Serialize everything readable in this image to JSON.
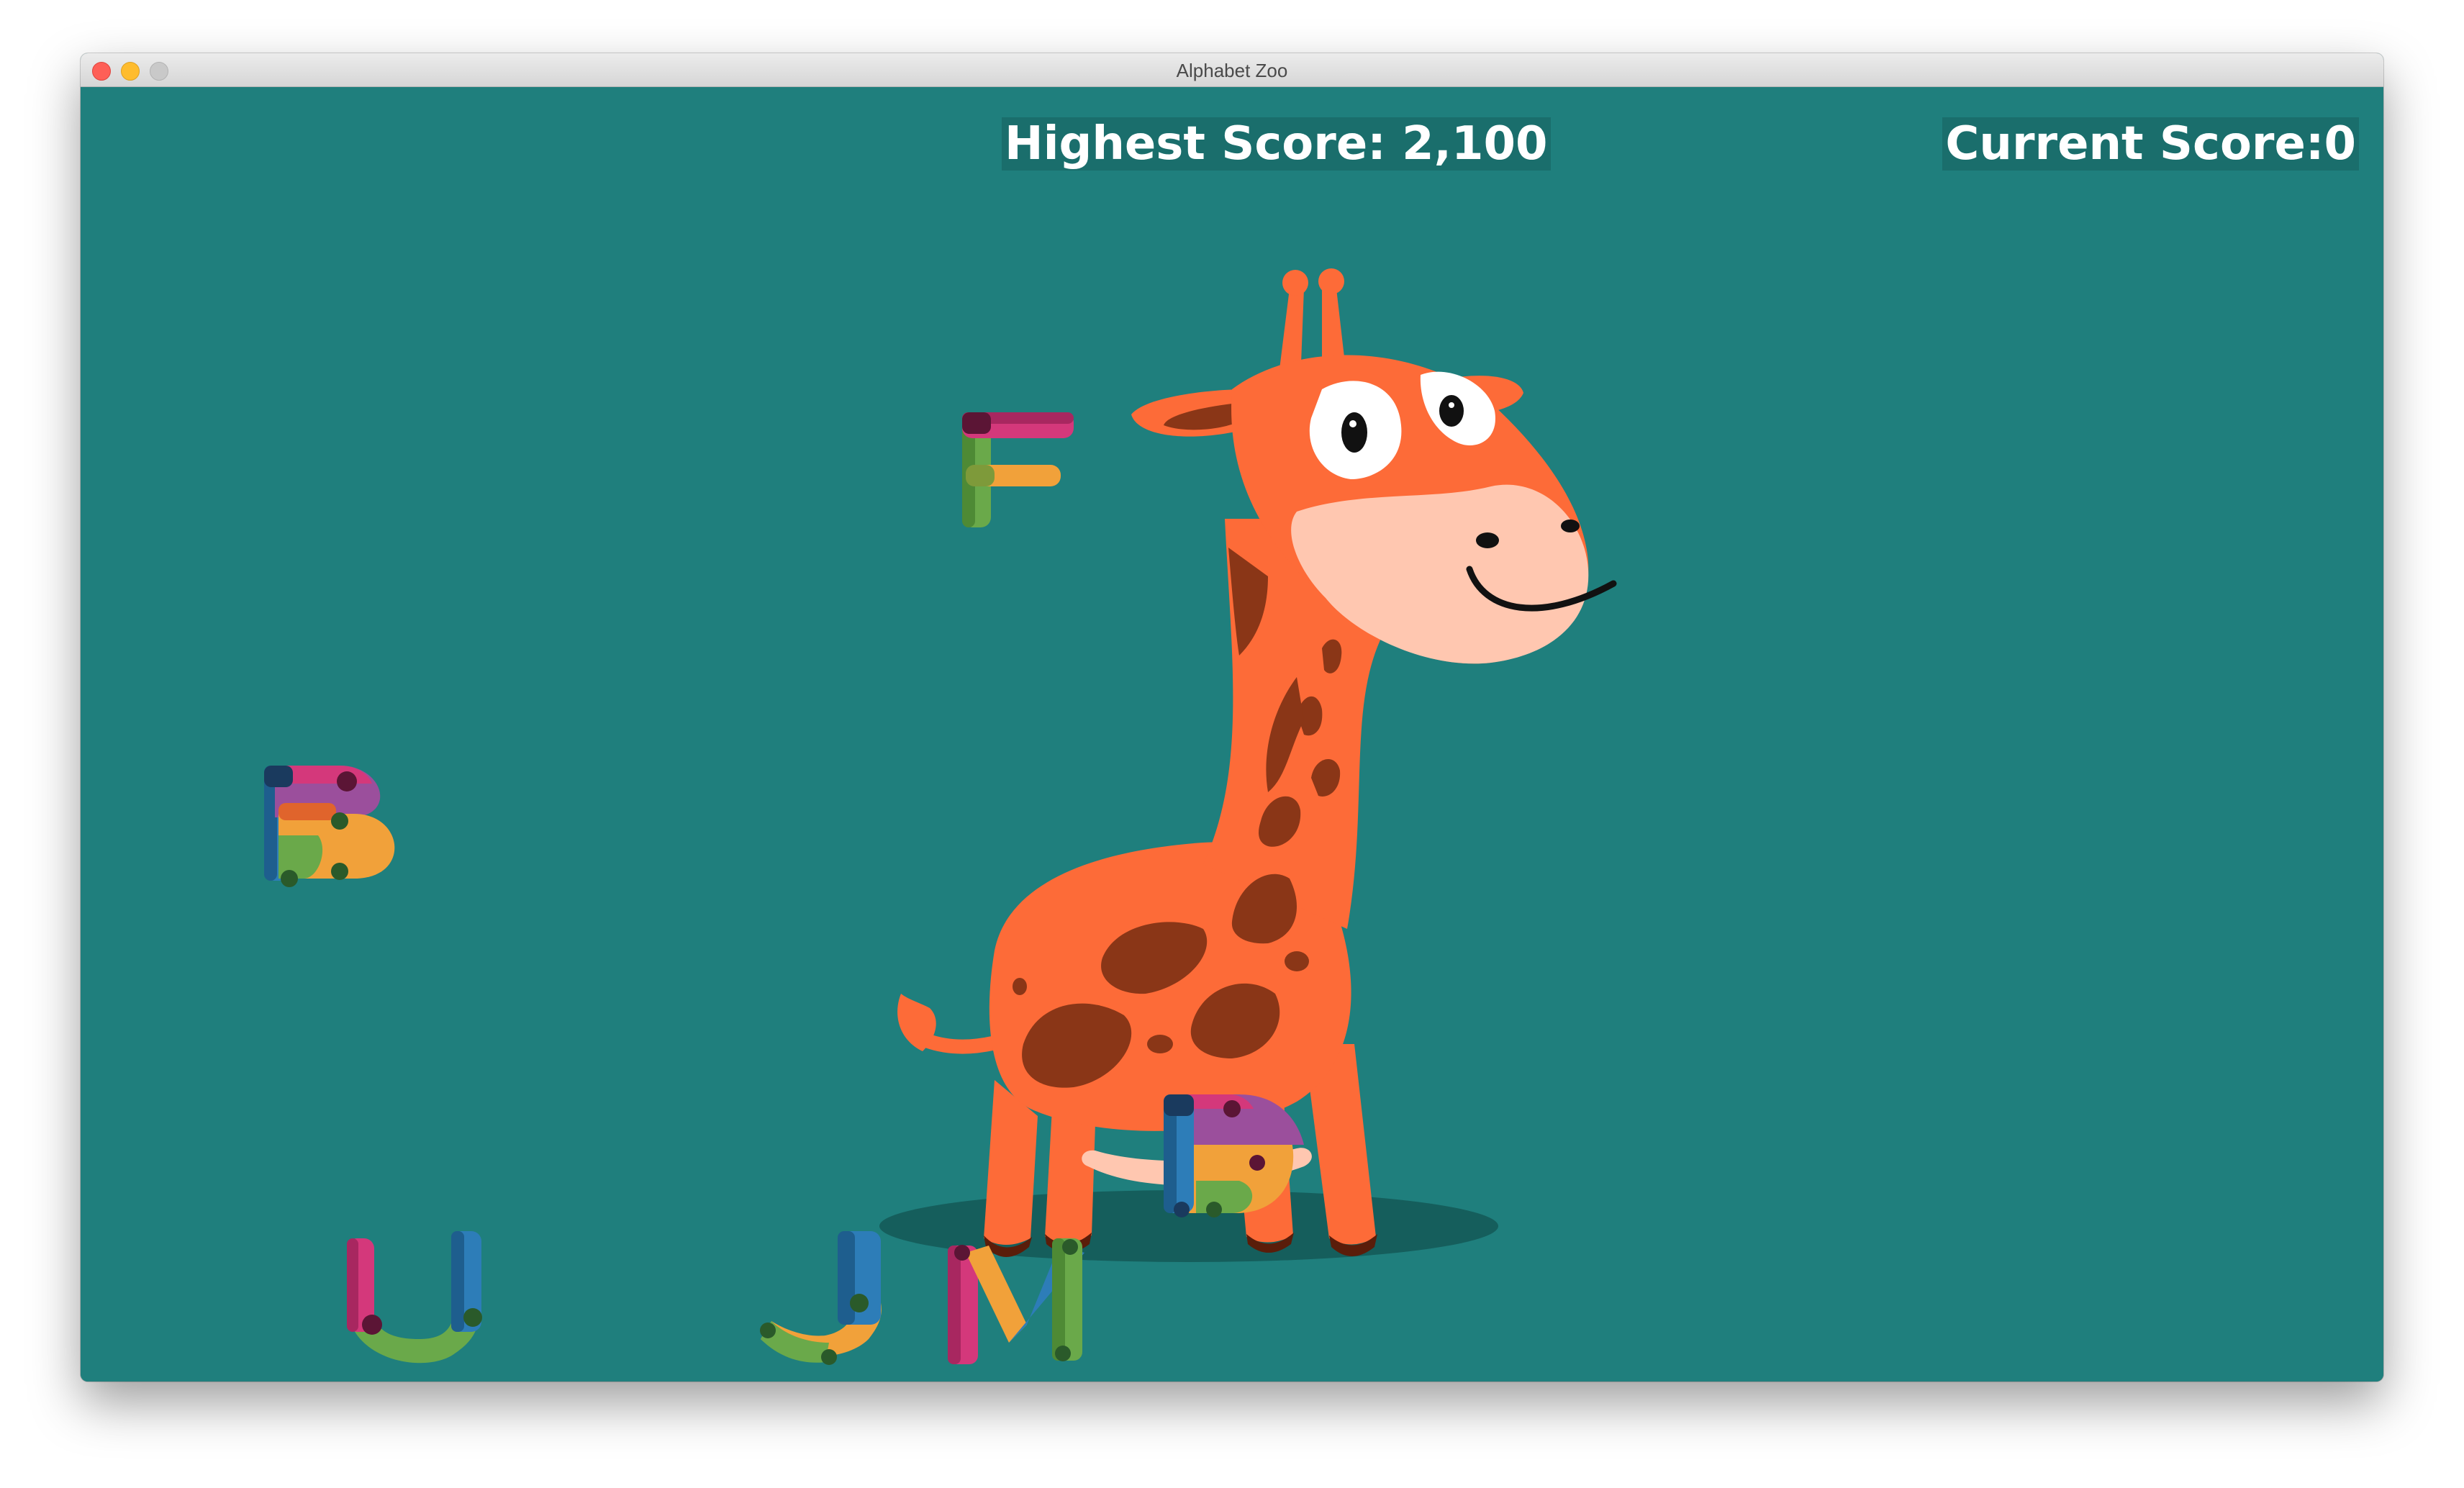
{
  "window": {
    "title": "Alphabet Zoo"
  },
  "hud": {
    "highest_score": "Highest Score: 2,100",
    "current_score": "Current Score:0"
  },
  "letters": [
    "F",
    "B",
    "D",
    "U",
    "J",
    "M"
  ],
  "colors": {
    "background": "#1f7f7d",
    "giraffe_body": "#fd6b38",
    "giraffe_spots": "#8a3617",
    "giraffe_muzzle": "#ffc7b0",
    "shadow": "#155e5c"
  }
}
